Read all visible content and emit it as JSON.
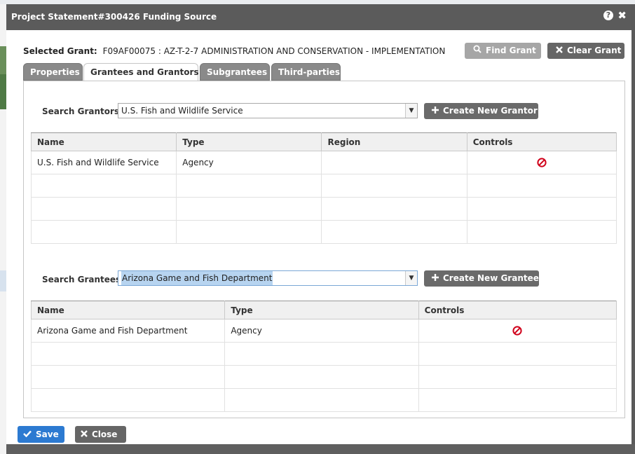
{
  "dialog": {
    "title": "Project Statement#300426 Funding Source",
    "help_icon": "?",
    "close_icon": "✖"
  },
  "selected_grant": {
    "label": "Selected Grant:",
    "value": "F09AF00075 : AZ-T-2-7 ADMINISTRATION AND CONSERVATION - IMPLEMENTATION"
  },
  "actions": {
    "find_grant": "Find Grant",
    "clear_grant": "Clear Grant"
  },
  "tabs": [
    {
      "label": "Properties",
      "active": false
    },
    {
      "label": "Grantees and Grantors",
      "active": true
    },
    {
      "label": "Subgrantees",
      "active": false
    },
    {
      "label": "Third-parties",
      "active": false
    }
  ],
  "grantors": {
    "search_label": "Search Grantors",
    "selected": "U.S. Fish and Wildlife Service",
    "create_button": "Create New Grantor",
    "columns": [
      "Name",
      "Type",
      "Region",
      "Controls"
    ],
    "rows": [
      {
        "name": "U.S. Fish and Wildlife Service",
        "type": "Agency",
        "region": ""
      }
    ]
  },
  "grantees": {
    "search_label": "Search Grantees",
    "selected": "Arizona Game and Fish Department",
    "create_button": "Create New Grantee",
    "columns": [
      "Name",
      "Type",
      "Controls"
    ],
    "rows": [
      {
        "name": "Arizona Game and Fish Department",
        "type": "Agency"
      }
    ]
  },
  "footer": {
    "save": "Save",
    "close": "Close"
  },
  "colors": {
    "titlebar": "#5b5b5b",
    "primary": "#2c7ad1",
    "delete_icon": "#d0021b"
  }
}
